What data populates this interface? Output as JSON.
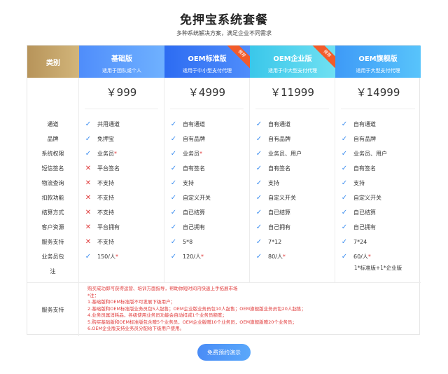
{
  "page": {
    "title": "免押宝系统套餐",
    "subtitle": "多种系统解决方案，满足企业不同需求"
  },
  "header": {
    "category_label": "类别",
    "plans": [
      {
        "name": "基础版",
        "desc": "适用于团队或个人",
        "ribbon": ""
      },
      {
        "name": "OEM标准版",
        "desc": "适用于中小型支付代理",
        "ribbon": "推荐"
      },
      {
        "name": "OEM企业版",
        "desc": "适用于中大型支付代理",
        "ribbon": "推荐"
      },
      {
        "name": "OEM旗舰版",
        "desc": "适用于大型支付代理",
        "ribbon": ""
      }
    ]
  },
  "prices": [
    "￥999",
    "￥4999",
    "￥11999",
    "￥14999"
  ],
  "categories": [
    "通道",
    "品牌",
    "系统权限",
    "短信签名",
    "物流查询",
    "扣款功能",
    "结算方式",
    "客户资源",
    "服务支持",
    "业务员包",
    "注"
  ],
  "plan_rows": [
    [
      {
        "mark": "yes",
        "text": "共用通道"
      },
      {
        "mark": "yes",
        "text": "免押宝"
      },
      {
        "mark": "yes",
        "text": "业务员",
        "star": "*"
      },
      {
        "mark": "no",
        "text": "平台签名"
      },
      {
        "mark": "no",
        "text": "不支持"
      },
      {
        "mark": "no",
        "text": "不支持"
      },
      {
        "mark": "no",
        "text": "不支持"
      },
      {
        "mark": "no",
        "text": "平台拥有"
      },
      {
        "mark": "no",
        "text": "不支持"
      },
      {
        "mark": "yes",
        "text": "150/人",
        "star": "*"
      }
    ],
    [
      {
        "mark": "yes",
        "text": "自有通道"
      },
      {
        "mark": "yes",
        "text": "自有品牌"
      },
      {
        "mark": "yes",
        "text": "业务员",
        "star": "*"
      },
      {
        "mark": "yes",
        "text": "自有签名"
      },
      {
        "mark": "yes",
        "text": "支持"
      },
      {
        "mark": "yes",
        "text": "自定义开关"
      },
      {
        "mark": "yes",
        "text": "自已结算"
      },
      {
        "mark": "yes",
        "text": "自己拥有"
      },
      {
        "mark": "yes",
        "text": "5*8"
      },
      {
        "mark": "yes",
        "text": "120/人",
        "star": "*"
      }
    ],
    [
      {
        "mark": "yes",
        "text": "自有通道"
      },
      {
        "mark": "yes",
        "text": "自有品牌"
      },
      {
        "mark": "yes",
        "text": "业务员、用户"
      },
      {
        "mark": "yes",
        "text": "自有签名"
      },
      {
        "mark": "yes",
        "text": "支持"
      },
      {
        "mark": "yes",
        "text": "自定义开关"
      },
      {
        "mark": "yes",
        "text": "自已结算"
      },
      {
        "mark": "yes",
        "text": "自己拥有"
      },
      {
        "mark": "yes",
        "text": "7*12"
      },
      {
        "mark": "yes",
        "text": "80/人",
        "star": "*"
      }
    ],
    [
      {
        "mark": "yes",
        "text": "自有通道"
      },
      {
        "mark": "yes",
        "text": "自有品牌"
      },
      {
        "mark": "yes",
        "text": "业务员、用户"
      },
      {
        "mark": "yes",
        "text": "自有签名"
      },
      {
        "mark": "yes",
        "text": "支持"
      },
      {
        "mark": "yes",
        "text": "自定义开关"
      },
      {
        "mark": "yes",
        "text": "自已结算"
      },
      {
        "mark": "yes",
        "text": "自己拥有"
      },
      {
        "mark": "yes",
        "text": "7*24"
      },
      {
        "mark": "yes",
        "text": "60/人",
        "star": "*"
      }
    ]
  ],
  "flagship_note": "1*标准版+1*企业版",
  "service": {
    "label": "服务支持",
    "lines": [
      "购买成功即可获得运营、培训方面指导，帮助你短时间内快速上手拓展市场",
      "*注：",
      "1.基础版和OEM标准版不可发展下级用户；",
      "2.基础版和OEM标准版业务员包5人起售；OEM企业版业务员包10人起售；OEM旗舰版业务员包20人起售；",
      "4.业务员属消耗品，各级使用业务员功能会自动扣减1个业务员额度；",
      "5.购买基础版和OEM标准版包含赠5个业务员，OEM企业版赠10个业务员，OEM旗舰版赠20个业务员；",
      "6.OEM企业版支持业务员分配给下级用户使用。"
    ]
  },
  "cta_label": "免费预约演示",
  "icons": {
    "yes": "check-icon",
    "no": "cross-icon"
  },
  "colors": {
    "check": "#3d8ef0",
    "cross": "#e03a3a",
    "category_gold": "#c4a56a",
    "ribbon": "#f25b2a"
  }
}
